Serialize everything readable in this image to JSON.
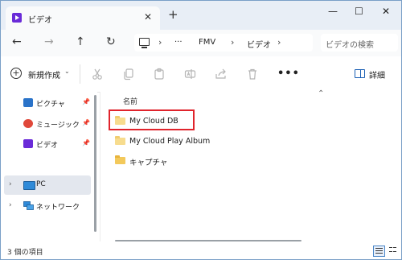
{
  "tab": {
    "title": "ビデオ",
    "close_glyph": "✕",
    "new_tab_glyph": "+"
  },
  "window_controls": {
    "minimize": "—",
    "maximize": "☐",
    "close": "✕"
  },
  "nav": {
    "back": "←",
    "forward": "→",
    "up": "↑",
    "refresh": "↻"
  },
  "address": {
    "sep1": "›",
    "ellipsis": "···",
    "crumb1": "FMV",
    "sep2": "›",
    "crumb2": "ビデオ",
    "sep3": "›"
  },
  "search": {
    "placeholder": "ビデオの検索"
  },
  "toolbar": {
    "new_label": "新規作成",
    "new_caret": "⌄",
    "more_label": "•••",
    "details_label": "詳細",
    "icons": [
      "cut-icon",
      "copy-icon",
      "paste-icon",
      "rename-icon",
      "share-icon",
      "delete-icon"
    ]
  },
  "sidebar": {
    "items": [
      {
        "label": "ピクチャ",
        "icon": "pictures-icon",
        "color": "#2a73c9",
        "pinned": true
      },
      {
        "label": "ミュージック",
        "icon": "music-icon",
        "color": "#e0483a",
        "pinned": true
      },
      {
        "label": "ビデオ",
        "icon": "videos-icon",
        "color": "#6a2bd8",
        "pinned": true
      }
    ],
    "pin_glyph": "📌",
    "pc": {
      "label": "PC",
      "chevron": "›"
    },
    "network": {
      "label": "ネットワーク",
      "chevron": "›"
    }
  },
  "content": {
    "column_name": "名前",
    "sort_glyph": "⌃",
    "files": [
      {
        "name": "My Cloud DB",
        "highlighted": true
      },
      {
        "name": "My Cloud Play Album",
        "highlighted": false
      },
      {
        "name": "キャプチャ",
        "highlighted": false
      }
    ],
    "highlight_color": "#e0242c"
  },
  "status": {
    "item_count": "3 個の項目"
  },
  "colors": {
    "accent": "#1a5fb4",
    "titlebar": "#e8eef6"
  }
}
